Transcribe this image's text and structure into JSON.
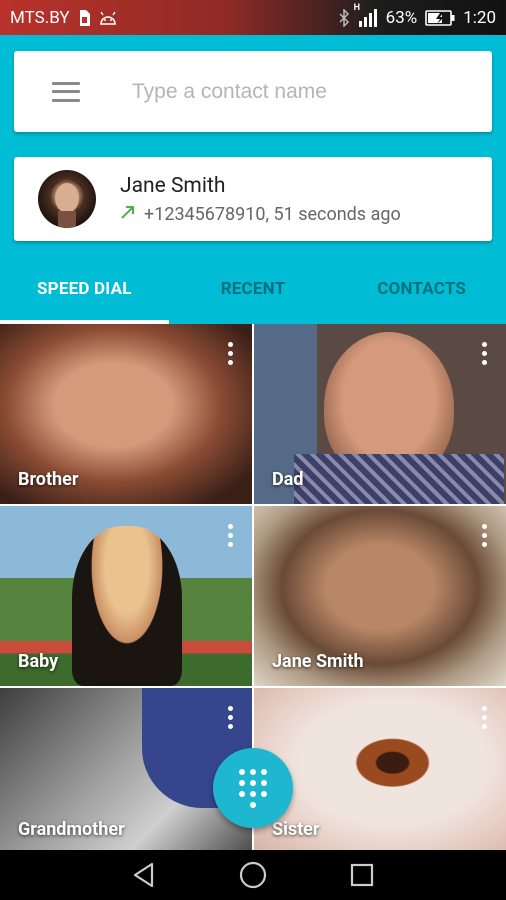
{
  "status_bar": {
    "carrier": "MTS.BY",
    "signal_type": "H",
    "battery": "63%",
    "time": "1:20"
  },
  "search": {
    "placeholder": "Type a contact name"
  },
  "recent_call": {
    "name": "Jane Smith",
    "detail": "+12345678910, 51 seconds ago",
    "call_type_icon": "outgoing-call-arrow-icon"
  },
  "tabs": [
    {
      "label": "SPEED DIAL",
      "active": true
    },
    {
      "label": "RECENT",
      "active": false
    },
    {
      "label": "CONTACTS",
      "active": false
    }
  ],
  "speed_dial": [
    {
      "name": "Brother"
    },
    {
      "name": "Dad"
    },
    {
      "name": "Baby"
    },
    {
      "name": "Jane Smith"
    },
    {
      "name": "Grandmother"
    },
    {
      "name": "Sister"
    }
  ],
  "colors": {
    "accent": "#00bcd4",
    "tab_inactive": "#00707d",
    "fab": "#1fb6d0"
  }
}
